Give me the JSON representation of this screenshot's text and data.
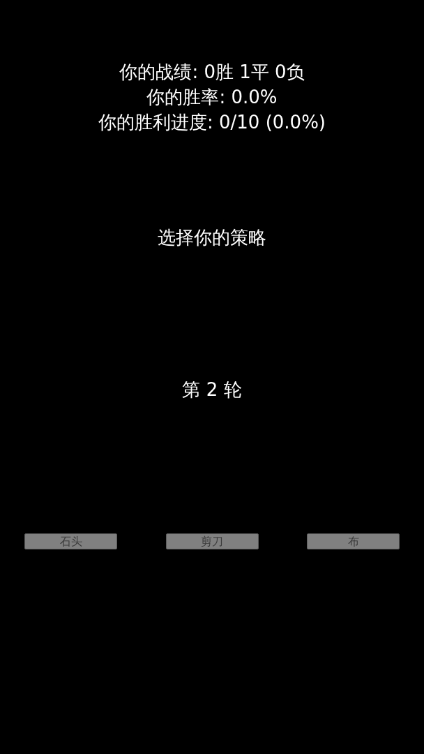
{
  "stats": [
    "你的战绩: 0胜 1平 0负",
    "你的胜率: 0.0%",
    "你的胜利进度: 0/10 (0.0%)"
  ],
  "prompt": "选择你的策略",
  "round": "第 2 轮",
  "buttons": [
    {
      "label": "石头"
    },
    {
      "label": "剪刀"
    },
    {
      "label": "布"
    }
  ]
}
